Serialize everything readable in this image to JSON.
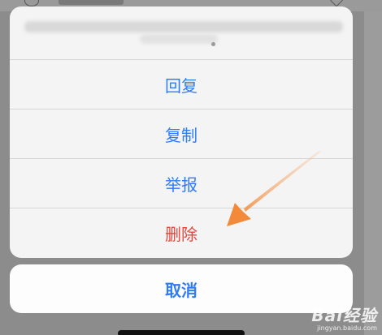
{
  "action_sheet": {
    "options": [
      {
        "label": "回复",
        "style": "default"
      },
      {
        "label": "复制",
        "style": "default"
      },
      {
        "label": "举报",
        "style": "default"
      },
      {
        "label": "删除",
        "style": "destructive"
      }
    ],
    "cancel_label": "取消"
  },
  "watermark": {
    "logo": "Bai经验",
    "url": "jingyan.baidu.com"
  },
  "colors": {
    "action_blue": "#2f7cf6",
    "destructive_red": "#e8453c",
    "annotation_arrow": "#f28a3a",
    "sheet_background": "#f4f4f4",
    "dim_overlay": "#8c8c8c"
  },
  "icons": [
    "avatar-icon",
    "heart-icon",
    "arrow-annotation-icon"
  ]
}
